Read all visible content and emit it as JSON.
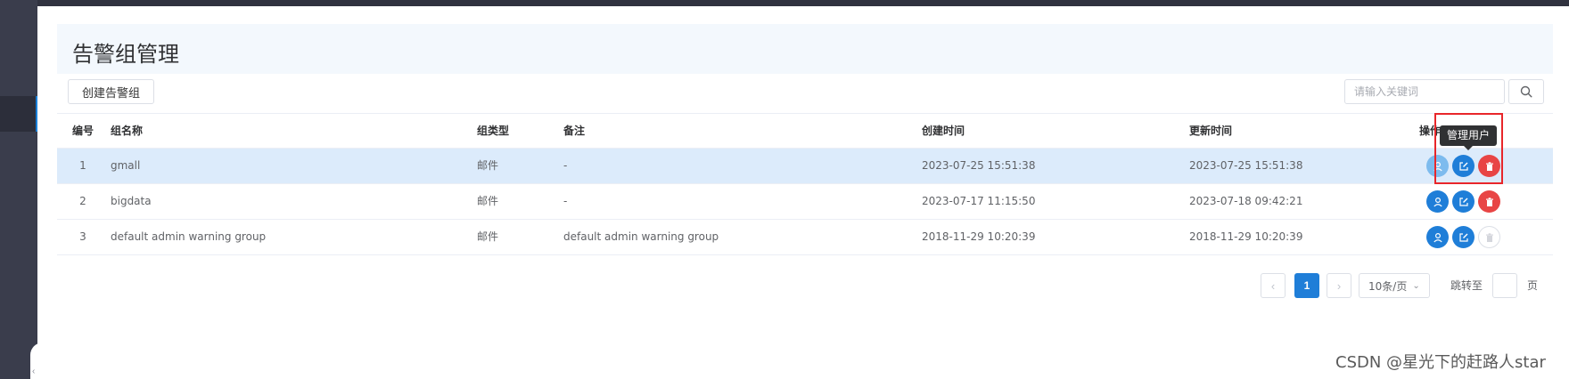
{
  "page": {
    "title": "告警组管理"
  },
  "toolbar": {
    "create_label": "创建告警组",
    "search_placeholder": "请输入关键词",
    "search_value": ""
  },
  "table": {
    "headers": {
      "no": "编号",
      "name": "组名称",
      "type": "组类型",
      "note": "备注",
      "created": "创建时间",
      "updated": "更新时间",
      "ops": "操作"
    },
    "rows": [
      {
        "no": "1",
        "name": "gmall",
        "type": "邮件",
        "note": "-",
        "created": "2023-07-25 15:51:38",
        "updated": "2023-07-25 15:51:38"
      },
      {
        "no": "2",
        "name": "bigdata",
        "type": "邮件",
        "note": "-",
        "created": "2023-07-17 11:15:50",
        "updated": "2023-07-18 09:42:21"
      },
      {
        "no": "3",
        "name": "default admin warning group",
        "type": "邮件",
        "note": "default admin warning group",
        "created": "2018-11-29 10:20:39",
        "updated": "2018-11-29 10:20:39"
      }
    ]
  },
  "tooltip": {
    "text": "管理用户"
  },
  "pagination": {
    "current_page": "1",
    "page_size_label": "10条/页",
    "jump_label": "跳转至",
    "page_suffix": "页"
  },
  "colors": {
    "primary": "#1f7ed8",
    "danger": "#e84545",
    "highlight_row": "#dcebfb",
    "annotation_frame": "#e8262a"
  },
  "watermark": {
    "text": "CSDN @星光下的赶路人star"
  }
}
